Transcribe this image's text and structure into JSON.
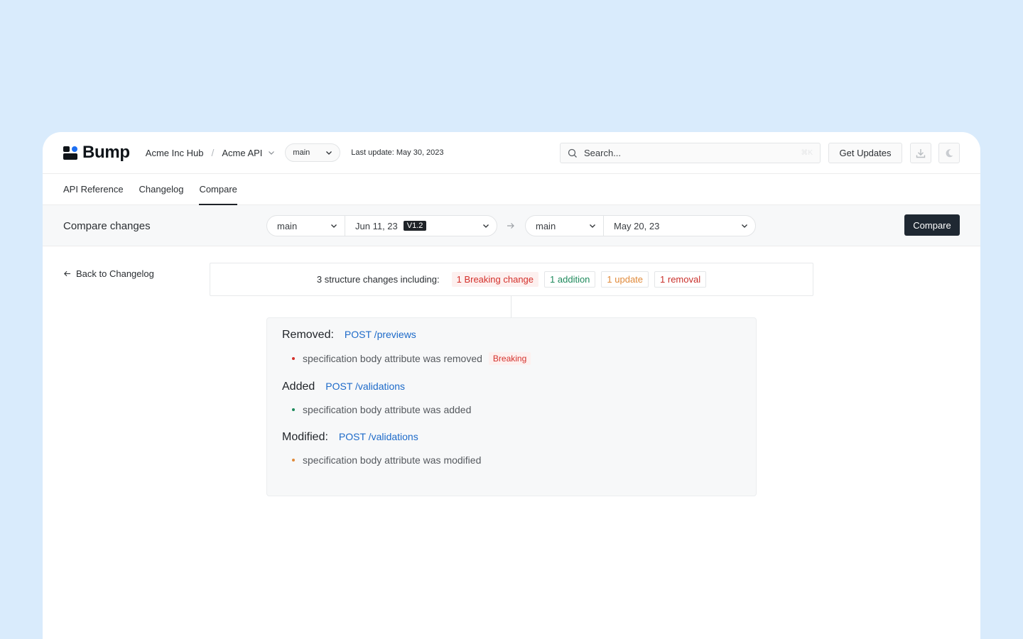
{
  "brand": {
    "name": "Bump"
  },
  "breadcrumb": {
    "hub": "Acme Inc Hub",
    "separator": "/",
    "api": "Acme API"
  },
  "branch_selector": {
    "value": "main"
  },
  "last_update": "Last update: May 30, 2023",
  "search": {
    "placeholder": "Search...",
    "shortcut": "⌘K"
  },
  "header_actions": {
    "get_updates": "Get Updates"
  },
  "tabs": [
    {
      "label": "API Reference",
      "active": false
    },
    {
      "label": "Changelog",
      "active": false
    },
    {
      "label": "Compare",
      "active": true
    }
  ],
  "compare_bar": {
    "title": "Compare changes",
    "from": {
      "branch": "main",
      "date": "Jun 11, 23",
      "version": "V1.2"
    },
    "to": {
      "branch": "main",
      "date": "May 20, 23"
    },
    "button": "Compare"
  },
  "back_link": "Back to Changelog",
  "summary": {
    "label": "3 structure changes including:",
    "breaking": "1 Breaking change",
    "addition": "1 addition",
    "update": "1 update",
    "removal": "1 removal"
  },
  "changes": [
    {
      "heading": "Removed:",
      "endpoint": "POST /previews",
      "item": "specification body attribute was removed",
      "badge": "Breaking"
    },
    {
      "heading": "Added",
      "endpoint": "POST /validations",
      "item": "specification body attribute was added"
    },
    {
      "heading": "Modified:",
      "endpoint": "POST /validations",
      "item": "specification body attribute was modified"
    }
  ],
  "colors": {
    "background": "#d9ebfc",
    "primary_button": "#1f2832",
    "link": "#1d6ac9",
    "breaking": "#d4302b",
    "addition": "#1e8a5c",
    "update": "#e08a3a"
  }
}
